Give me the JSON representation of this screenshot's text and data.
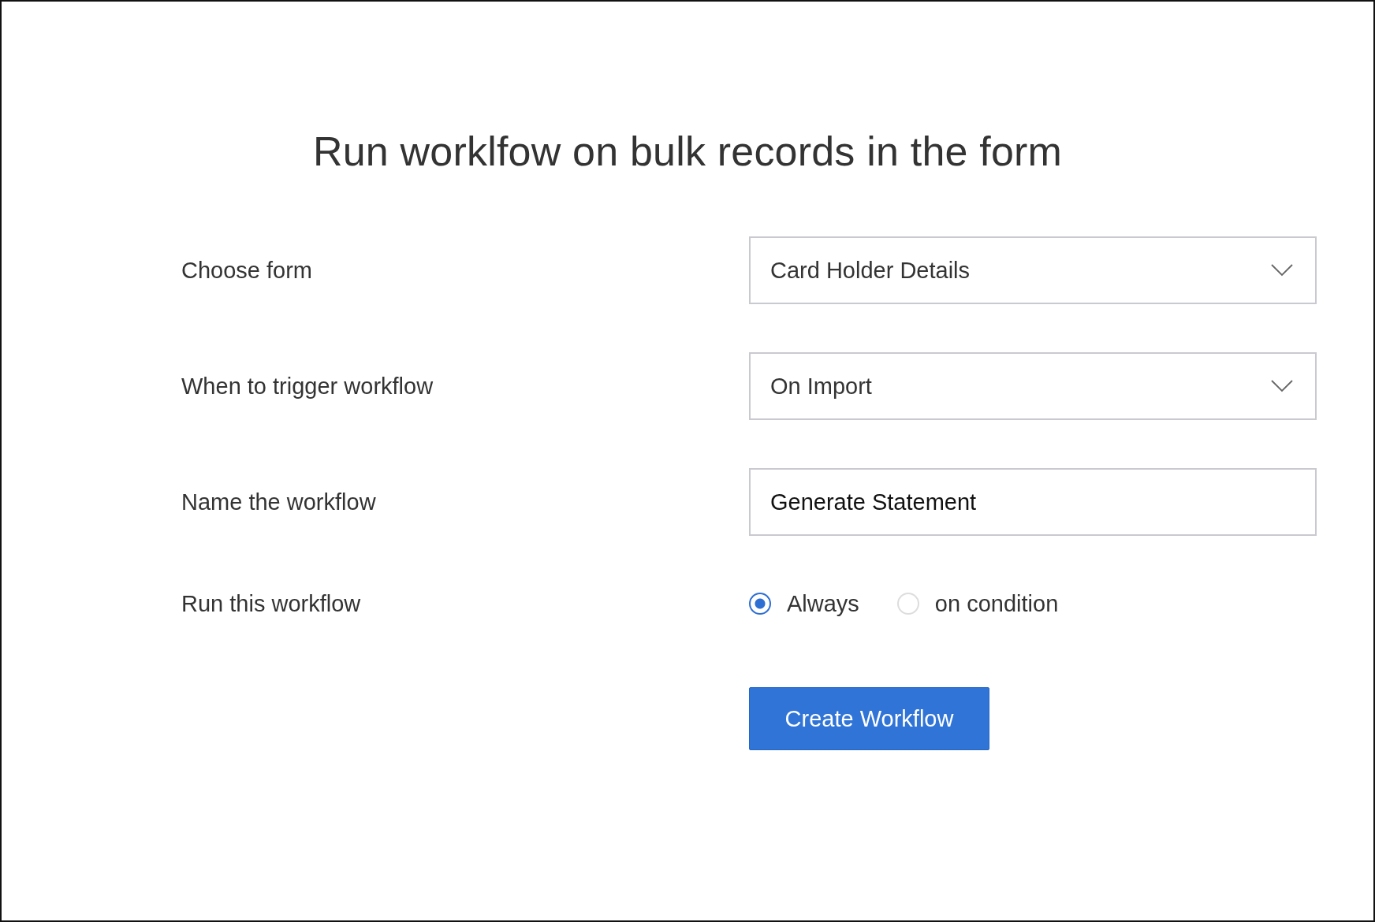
{
  "title": "Run worklfow on bulk records in the form",
  "fields": [
    {
      "kind": "select",
      "label": "Choose form",
      "value": "Card Holder Details"
    },
    {
      "kind": "select",
      "label": "When to trigger workflow",
      "value": "On Import"
    },
    {
      "kind": "text",
      "label": "Name the workflow",
      "value": "Generate Statement"
    },
    {
      "kind": "radio",
      "label": "Run this workflow",
      "options": [
        {
          "label": "Always",
          "selected": true
        },
        {
          "label": "on condition",
          "selected": false
        }
      ]
    }
  ],
  "button": "Create Workflow"
}
